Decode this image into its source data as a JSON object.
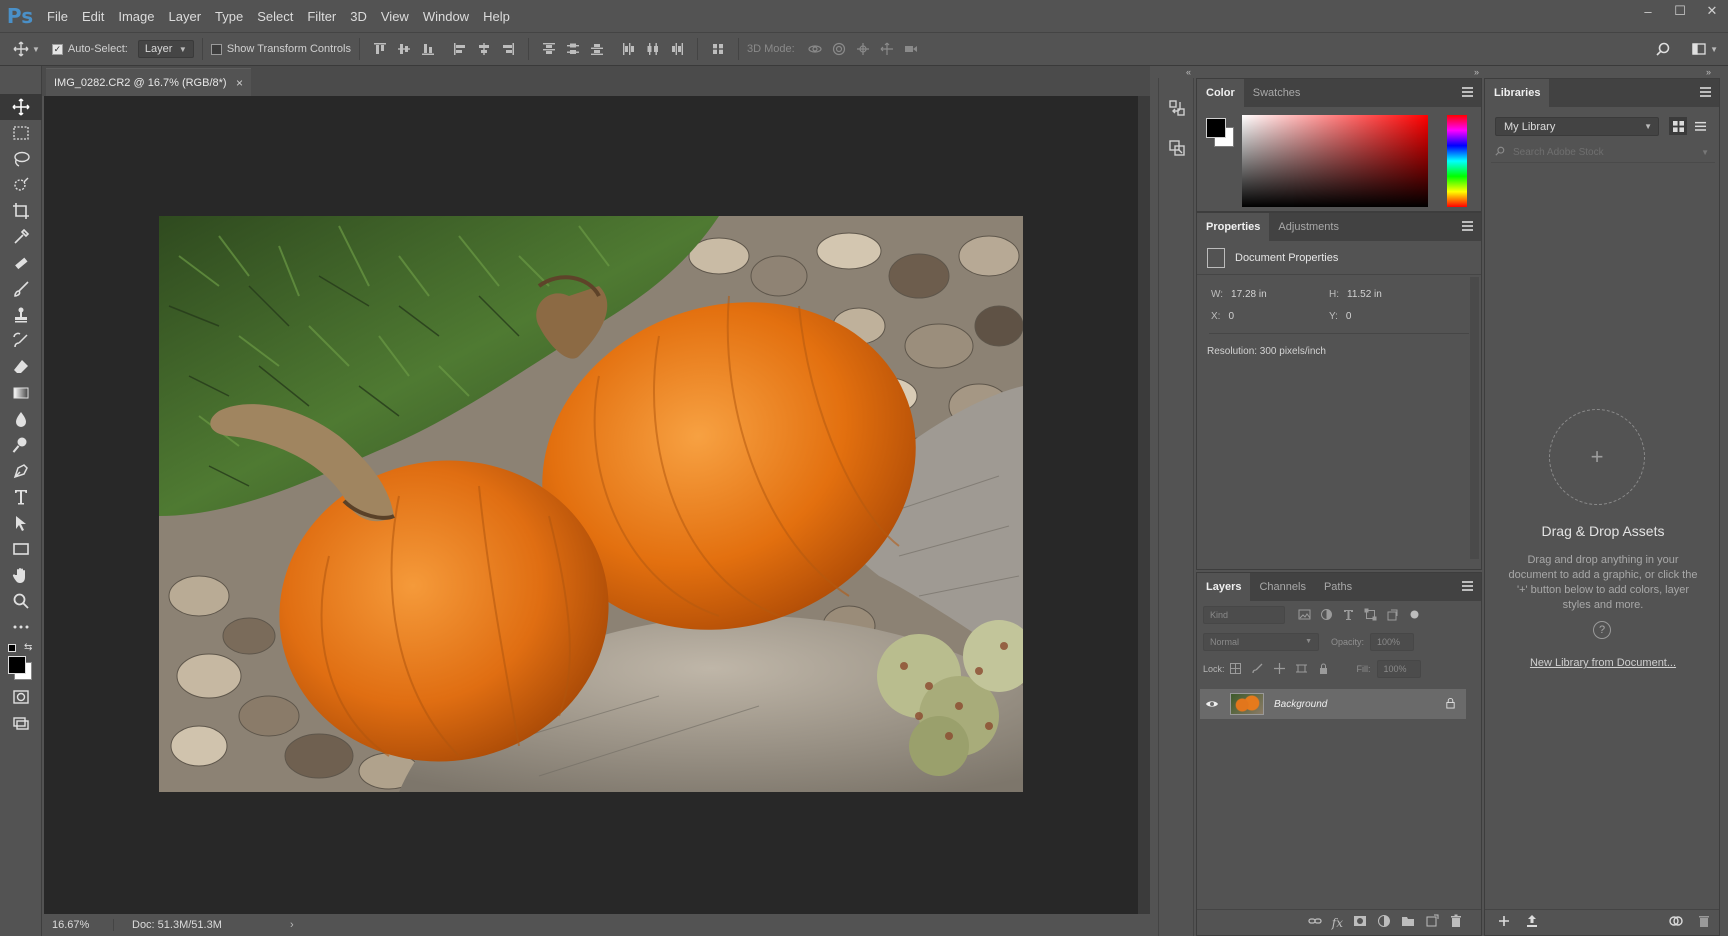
{
  "app": {
    "logo": "Ps"
  },
  "menu": [
    "File",
    "Edit",
    "Image",
    "Layer",
    "Type",
    "Select",
    "Filter",
    "3D",
    "View",
    "Window",
    "Help"
  ],
  "window_controls": {
    "minimize": "–",
    "maximize": "☐",
    "close": "✕"
  },
  "options_bar": {
    "auto_select_label": "Auto-Select:",
    "auto_select_checked": true,
    "auto_select_target": "Layer",
    "show_transform_label": "Show Transform Controls",
    "show_transform_checked": false,
    "mode_3d_label": "3D Mode:"
  },
  "document": {
    "tab_title": "IMG_0282.CR2 @ 16.7% (RGB/8*)",
    "tab_close": "×",
    "zoom": "16.67%",
    "doc_size": "Doc: 51.3M/51.3M",
    "status_arrow": "›"
  },
  "color_panel": {
    "tabs": [
      "Color",
      "Swatches"
    ],
    "active_tab": "Color",
    "foreground": "#000000",
    "background": "#ffffff"
  },
  "properties_panel": {
    "tabs": [
      "Properties",
      "Adjustments"
    ],
    "heading": "Document Properties",
    "w_label": "W:",
    "w_value": "17.28 in",
    "h_label": "H:",
    "h_value": "11.52 in",
    "x_label": "X:",
    "x_value": "0",
    "y_label": "Y:",
    "y_value": "0",
    "resolution": "Resolution: 300 pixels/inch"
  },
  "layers_panel": {
    "tabs": [
      "Layers",
      "Channels",
      "Paths"
    ],
    "kind_placeholder": "Kind",
    "blend_mode": "Normal",
    "opacity_label": "Opacity:",
    "opacity_value": "100%",
    "lock_label": "Lock:",
    "fill_label": "Fill:",
    "fill_value": "100%",
    "layers": [
      {
        "name": "Background",
        "visible": true,
        "locked": true
      }
    ]
  },
  "libraries_panel": {
    "tab": "Libraries",
    "library_name": "My Library",
    "search_placeholder": "Search Adobe Stock",
    "drop_title": "Drag & Drop Assets",
    "drop_text": "Drag and drop anything in your document to add a graphic, or click the '+' button below to add colors, layer styles and more.",
    "help_glyph": "?",
    "plus_glyph": "+",
    "new_library_link": "New Library from Document..."
  }
}
